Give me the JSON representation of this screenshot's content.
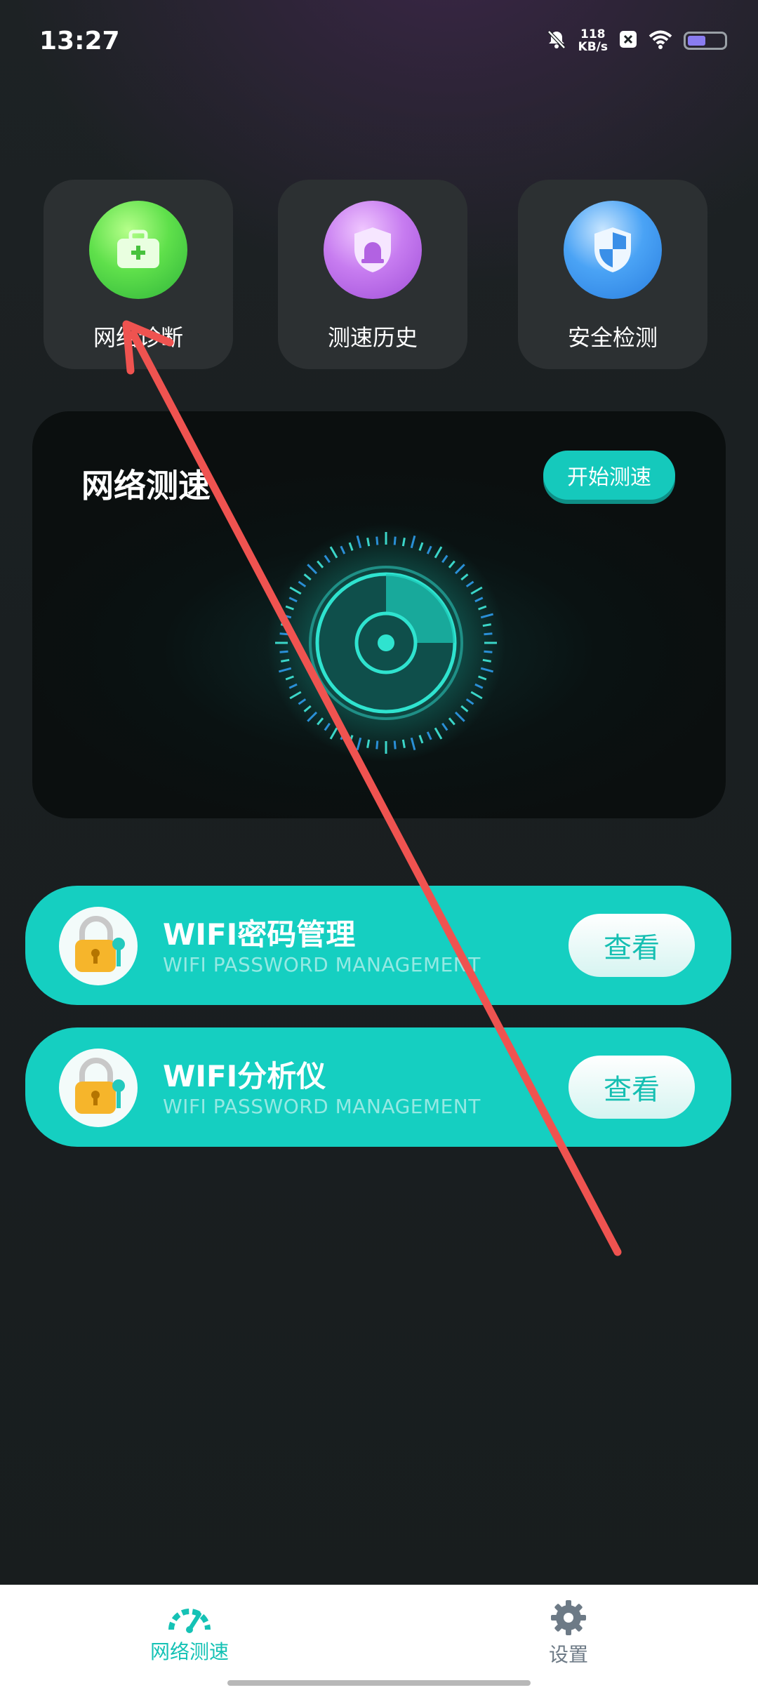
{
  "status_bar": {
    "time": "13:27",
    "net_speed_value": "118",
    "net_speed_unit": "KB/s",
    "battery_level": 0.5
  },
  "tiles": [
    {
      "label": "网络诊断",
      "icon": "toolbox-icon",
      "color": "#5fe04b"
    },
    {
      "label": "测速历史",
      "icon": "alarm-shield-icon",
      "color": "#c77cf0"
    },
    {
      "label": "安全检测",
      "icon": "security-shield-icon",
      "color": "#4aa3f5"
    }
  ],
  "speed_card": {
    "title": "网络测速",
    "start_label": "开始测速",
    "gauge_icon": "speed-dial-icon"
  },
  "banners": [
    {
      "title": "WIFI密码管理",
      "subtitle": "WIFI PASSWORD MANAGEMENT",
      "button": "查看",
      "icon": "padlock-key-icon"
    },
    {
      "title": "WIFI分析仪",
      "subtitle": "WIFI PASSWORD MANAGEMENT",
      "button": "查看",
      "icon": "padlock-key-icon"
    }
  ],
  "tab_bar": [
    {
      "label": "网络测速",
      "icon": "speedometer-icon",
      "active": true
    },
    {
      "label": "设置",
      "icon": "gear-icon",
      "active": false
    }
  ],
  "colors": {
    "accent": "#15cfc1",
    "background": "#1a1f21",
    "annotation_arrow": "#ef5350"
  }
}
